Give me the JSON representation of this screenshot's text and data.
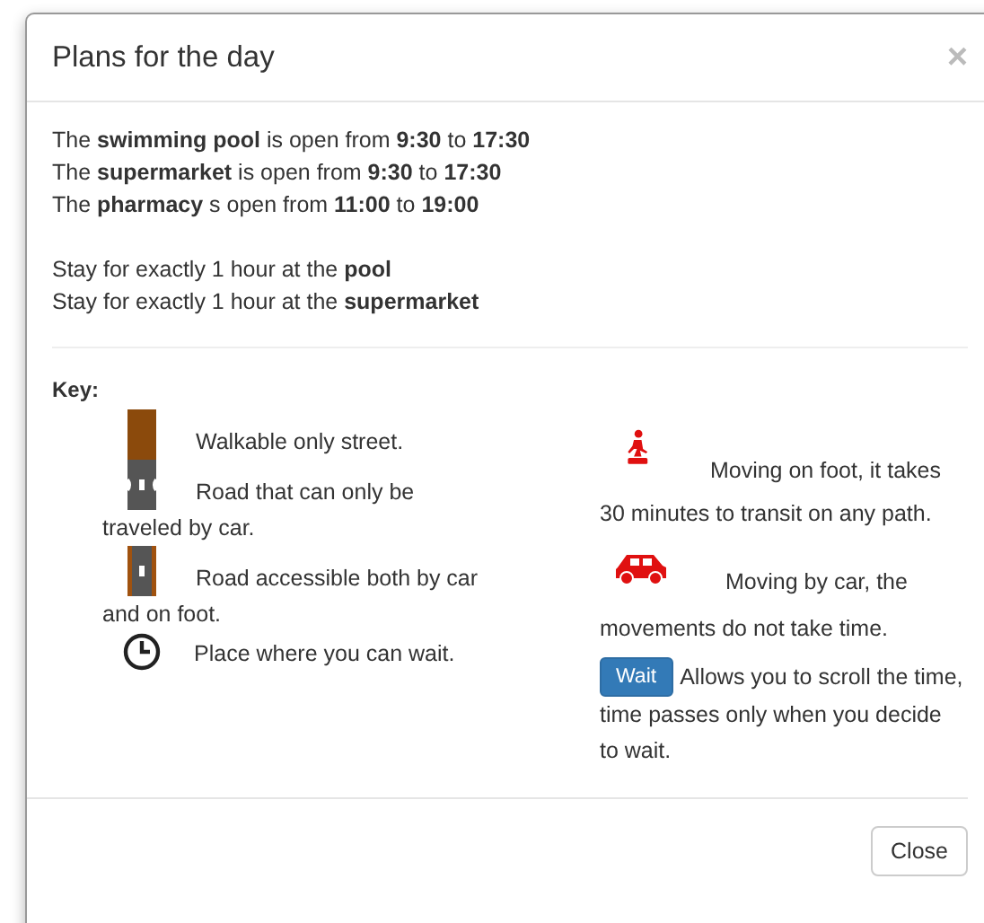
{
  "modal": {
    "title": "Plans for the day",
    "close_symbol": "×"
  },
  "schedule": [
    "The **swimming pool** is open from **9:30** to **17:30**",
    "The **supermarket** is open from **9:30** to **17:30**",
    "The **pharmacy** s open from **11:00** to **19:00**"
  ],
  "stays": [
    "Stay for exactly 1 hour at the **pool**",
    "Stay for exactly 1 hour at the **supermarket**"
  ],
  "key": {
    "title": "Key:",
    "left": [
      {
        "kind": "walkable",
        "lines": [
          "Walkable only street."
        ]
      },
      {
        "kind": "car-road",
        "lines": [
          "Road that can only be",
          "traveled by car."
        ]
      },
      {
        "kind": "mixed-road",
        "lines": [
          "Road accessible both by car",
          "and on foot."
        ]
      },
      {
        "kind": "clock",
        "lines": [
          "Place where you can wait."
        ]
      }
    ],
    "right": [
      {
        "kind": "walker",
        "lines": [
          "Moving on foot, it takes",
          "30 minutes to transit on any path."
        ]
      },
      {
        "kind": "car",
        "lines": [
          "Moving by car, the",
          "movements do not take time."
        ]
      },
      {
        "kind": "wait-button",
        "label": "Wait",
        "lines": [
          "Allows you to scroll the time,",
          "time passes only when you decide",
          "to wait."
        ]
      }
    ]
  },
  "footer": {
    "close_button": "Close"
  }
}
